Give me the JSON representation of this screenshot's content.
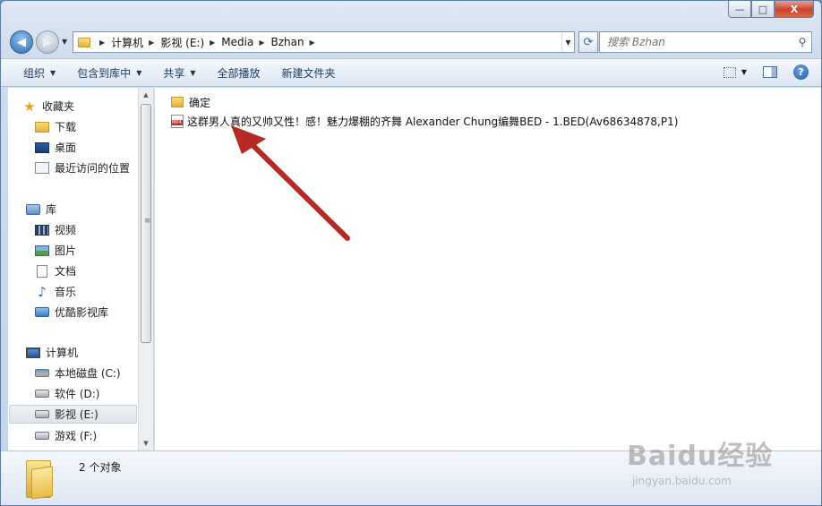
{
  "window": {
    "caption_buttons": {
      "minimize": "—",
      "maximize": "□",
      "close": "X"
    }
  },
  "nav": {
    "back": "◀",
    "forward": "▶",
    "breadcrumb": [
      "计算机",
      "影视 (E:)",
      "Media",
      "Bzhan"
    ],
    "search_placeholder": "搜索 Bzhan"
  },
  "toolbar": {
    "organize": "组织",
    "include_in_library": "包含到库中",
    "share": "共享",
    "play_all": "全部播放",
    "new_folder": "新建文件夹"
  },
  "sidebar": {
    "favorites": {
      "label": "收藏夹",
      "items": [
        "下载",
        "桌面",
        "最近访问的位置"
      ]
    },
    "libraries": {
      "label": "库",
      "items": [
        "视频",
        "图片",
        "文档",
        "音乐",
        "优酷影视库"
      ]
    },
    "computer": {
      "label": "计算机",
      "items": [
        "本地磁盘 (C:)",
        "软件 (D:)",
        "影视 (E:)",
        "游戏 (F:)"
      ]
    }
  },
  "files": [
    {
      "name": "确定",
      "type": "folder"
    },
    {
      "name": "这群男人真的又帅又性！感！魅力爆棚的齐舞  Alexander Chung编舞BED - 1.BED(Av68634878,P1)",
      "type": "mp4",
      "badge": "MP4"
    }
  ],
  "status": {
    "count": "2 个对象"
  },
  "watermark": {
    "brand": "Baidu经验",
    "url": "jingyan.baidu.com"
  },
  "colors": {
    "accent": "#2b6fb3",
    "arrow": "#b52a22",
    "selected_bg": "#dfe4ea"
  }
}
